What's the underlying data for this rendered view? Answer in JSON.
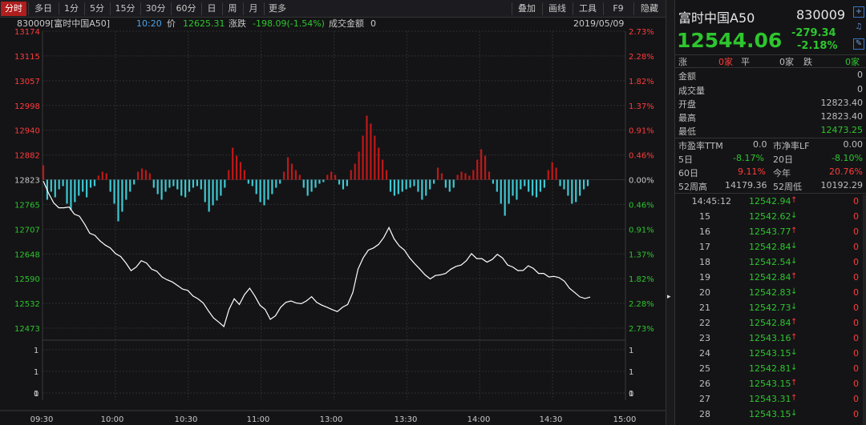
{
  "toolbar": {
    "periods": [
      "分时",
      "多日",
      "1分",
      "5分",
      "15分",
      "30分",
      "60分",
      "日",
      "周",
      "月",
      "更多"
    ],
    "tools": [
      "叠加",
      "画线",
      "工具",
      "F9",
      "隐藏"
    ]
  },
  "info": {
    "code_name": "830009[富时中国A50]",
    "time": "10:20",
    "price_label": "价",
    "price": "12625.31",
    "change_label": "涨跌",
    "change": "-198.09(-1.54%)",
    "turnover_label": "成交金额",
    "turnover": "0",
    "date": "2019/05/09"
  },
  "colors": {
    "up": "#ff3b3b",
    "down": "#2ec52e",
    "bar_up": "#c01818",
    "bar_down": "#3ec8d2",
    "line": "#ffffff",
    "grid": "#2e2e33"
  },
  "chart_data": {
    "type": "line",
    "y_left_ticks": [
      "13174",
      "13115",
      "13057",
      "12998",
      "12940",
      "12882",
      "12823",
      "12765",
      "12707",
      "12648",
      "12590",
      "12532",
      "12473"
    ],
    "y_right_ticks": [
      "2.73%",
      "2.28%",
      "1.82%",
      "1.37%",
      "0.91%",
      "0.46%",
      "0.00%",
      "0.46%",
      "0.91%",
      "1.37%",
      "1.82%",
      "2.28%",
      "2.73%"
    ],
    "volume_ticks": [
      "1",
      "1",
      "1",
      "0"
    ],
    "x_ticks": [
      "09:30",
      "10:00",
      "10:30",
      "11:00",
      "13:00",
      "13:30",
      "14:00",
      "14:30",
      "15:00"
    ],
    "prev_close": 12823.4,
    "ylim": [
      12473,
      13174
    ],
    "price_series": [
      12823,
      12790,
      12770,
      12760,
      12755,
      12760,
      12745,
      12735,
      12720,
      12700,
      12690,
      12680,
      12672,
      12660,
      12650,
      12645,
      12625,
      12610,
      12620,
      12630,
      12628,
      12615,
      12605,
      12595,
      12590,
      12580,
      12575,
      12568,
      12560,
      12550,
      12545,
      12530,
      12515,
      12500,
      12485,
      12478,
      12520,
      12540,
      12530,
      12555,
      12565,
      12550,
      12530,
      12515,
      12495,
      12505,
      12520,
      12535,
      12540,
      12530,
      12532,
      12540,
      12545,
      12535,
      12530,
      12520,
      12518,
      12515,
      12520,
      12530,
      12560,
      12610,
      12640,
      12660,
      12660,
      12672,
      12690,
      12708,
      12685,
      12670,
      12655,
      12640,
      12628,
      12610,
      12600,
      12592,
      12595,
      12600,
      12605,
      12610,
      12620,
      12625,
      12630,
      12650,
      12640,
      12635,
      12630,
      12638,
      12645,
      12640,
      12625,
      12615,
      12610,
      12612,
      12618,
      12615,
      12605,
      12600,
      12595,
      12598,
      12590,
      12585,
      12570,
      12555,
      12548,
      12546,
      12544
    ],
    "volume_bars": [
      18,
      -25,
      -15,
      -22,
      -12,
      -8,
      -30,
      -38,
      -28,
      -20,
      -15,
      -22,
      -10,
      -8,
      5,
      10,
      8,
      -15,
      -30,
      -52,
      -40,
      -25,
      -15,
      -6,
      10,
      14,
      12,
      8,
      -10,
      -18,
      -25,
      -15,
      -10,
      -8,
      -12,
      -20,
      -22,
      -15,
      -10,
      -8,
      -12,
      -28,
      -40,
      -32,
      -26,
      -20,
      -10,
      12,
      40,
      30,
      22,
      12,
      -5,
      -8,
      -18,
      -28,
      -32,
      -25,
      -18,
      -10,
      -5,
      10,
      28,
      20,
      12,
      6,
      -10,
      -20,
      -15,
      -10,
      -5,
      -3,
      6,
      10,
      6,
      -6,
      -12,
      -8,
      12,
      20,
      35,
      55,
      80,
      70,
      55,
      40,
      25,
      12,
      -15,
      -20,
      -18,
      -15,
      -12,
      -10,
      -8,
      -15,
      -25,
      -20,
      -12,
      -5,
      15,
      8,
      -10,
      -15,
      -10,
      6,
      10,
      8,
      5,
      12,
      25,
      38,
      30,
      10,
      -5,
      -15,
      -30,
      -45,
      -30,
      -20,
      -25,
      -12,
      -8,
      -15,
      -20,
      -22,
      -15,
      -10,
      12,
      22,
      15,
      -8,
      -12,
      -20,
      -30,
      -28,
      -20,
      -12,
      -8
    ]
  },
  "panel": {
    "title": "富时中国A50",
    "code": "830009",
    "last": "12544.06",
    "change": "-279.34",
    "change_pct": "-2.18%",
    "breadth": [
      {
        "label": "涨",
        "value": "0家"
      },
      {
        "label": "平",
        "value": "0家"
      },
      {
        "label": "跌",
        "value": "0家"
      }
    ],
    "stats": [
      {
        "label": "金额",
        "value": "0"
      },
      {
        "label": "成交量",
        "value": "0"
      },
      {
        "label": "开盘",
        "value": "12823.40"
      },
      {
        "label": "最高",
        "value": "12823.40"
      },
      {
        "label": "最低",
        "value": "12473.25"
      }
    ],
    "valuation": {
      "pe_label": "市盈率TTM",
      "pe_value": "0.0",
      "pb_label": "市净率LF",
      "pb_value": "0.00",
      "d5_label": "5日",
      "d5_value": "-8.17%",
      "d20_label": "20日",
      "d20_value": "-8.10%",
      "d60_label": "60日",
      "d60_value": "9.11%",
      "ytd_label": "今年",
      "ytd_value": "20.76%",
      "hi52_label": "52周高",
      "hi52_value": "14179.36",
      "lo52_label": "52周低",
      "lo52_value": "10192.29"
    },
    "ticks": [
      {
        "time": "14:45:12",
        "price": "12542.94",
        "dir": "up",
        "vol": "0"
      },
      {
        "time": "15",
        "price": "12542.62",
        "dir": "down",
        "vol": "0"
      },
      {
        "time": "16",
        "price": "12543.77",
        "dir": "up",
        "vol": "0"
      },
      {
        "time": "17",
        "price": "12542.84",
        "dir": "down",
        "vol": "0"
      },
      {
        "time": "18",
        "price": "12542.54",
        "dir": "down",
        "vol": "0"
      },
      {
        "time": "19",
        "price": "12542.84",
        "dir": "up",
        "vol": "0"
      },
      {
        "time": "20",
        "price": "12542.83",
        "dir": "down",
        "vol": "0"
      },
      {
        "time": "21",
        "price": "12542.73",
        "dir": "down",
        "vol": "0"
      },
      {
        "time": "22",
        "price": "12542.84",
        "dir": "up",
        "vol": "0"
      },
      {
        "time": "23",
        "price": "12543.16",
        "dir": "up",
        "vol": "0"
      },
      {
        "time": "24",
        "price": "12543.15",
        "dir": "down",
        "vol": "0"
      },
      {
        "time": "25",
        "price": "12542.81",
        "dir": "down",
        "vol": "0"
      },
      {
        "time": "26",
        "price": "12543.15",
        "dir": "up",
        "vol": "0"
      },
      {
        "time": "27",
        "price": "12543.31",
        "dir": "up",
        "vol": "0"
      },
      {
        "time": "28",
        "price": "12543.15",
        "dir": "down",
        "vol": "0"
      }
    ]
  }
}
